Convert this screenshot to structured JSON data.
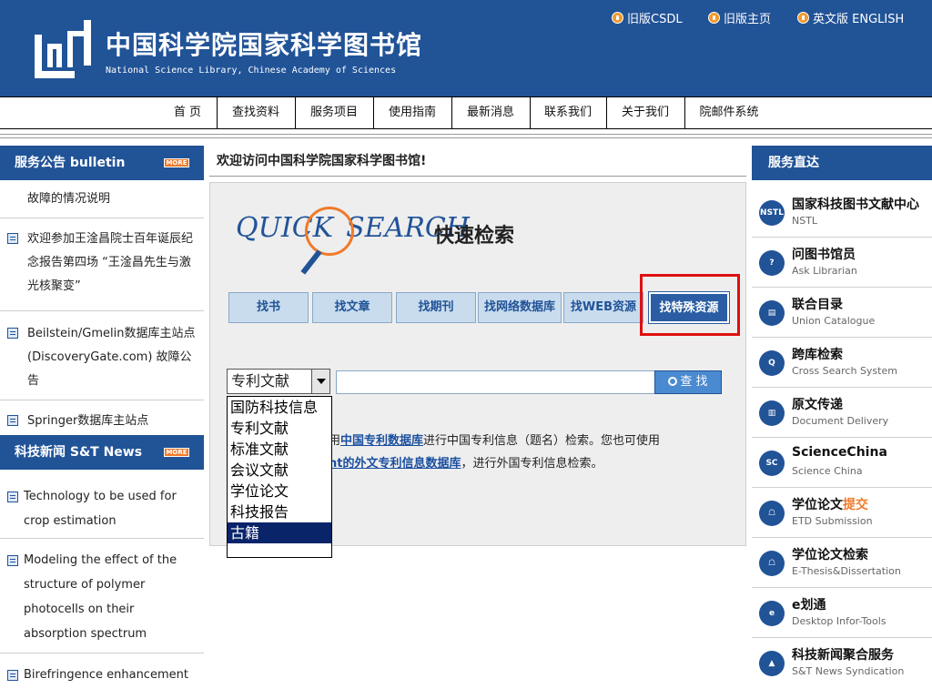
{
  "header": {
    "logo_text": "[]",
    "title": "中国科学院国家科学图书馆",
    "subtitle": "National Science Library, Chinese Academy of Sciences",
    "top_links": [
      "旧版CSDL",
      "旧版主页",
      "英文版 ENGLISH"
    ]
  },
  "nav": {
    "items": [
      "首 页",
      "查找资料",
      "服务项目",
      "使用指南",
      "最新消息",
      "联系我们",
      "关于我们",
      "院邮件系统"
    ]
  },
  "bulletin": {
    "title": "服务公告 bulletin",
    "more": "MORE",
    "items": [
      "故障的情况说明",
      "欢迎参加王淦昌院士百年诞辰纪念报告第四场 “王淦昌先生与激光核聚变”",
      "Beilstein/Gmelin数据库主站点 (DiscoveryGate.com) 故障公告",
      "Springer数据库主站点"
    ]
  },
  "news": {
    "title": "科技新闻 S&T News",
    "more": "MORE",
    "items": [
      "Technology to be used for crop estimation",
      "Modeling the effect of the structure of polymer photocells on their absorption spectrum",
      "Birefringence enhancement"
    ]
  },
  "center": {
    "welcome": "欢迎访问中国科学院国家科学图书馆!",
    "qs_logo_a": "QUICK",
    "qs_logo_b": "SEARCH",
    "qs_title": "快速检索",
    "tabs": [
      "找书",
      "找文章",
      "找期刊",
      "找网络数据库",
      "找WEB资源",
      "找特殊资源"
    ],
    "select_value": "专利文献",
    "search_value": "",
    "search_button": "查 找",
    "hint1_pre": "用",
    "hint1_link": "中国专利数据库",
    "hint1_post": "进行中国专利信息（题名）检索。您也可使用",
    "hint2_link": "nt的外文专利信息数据库",
    "hint2_post": "，进行外国专利信息检索。",
    "dropdown_options": [
      "国防科技信息",
      "专利文献",
      "标准文献",
      "会议文献",
      "学位论文",
      "科技报告",
      "古籍"
    ]
  },
  "services": {
    "title": "服务直达",
    "items": [
      {
        "icon": "NSTL",
        "title": "国家科技图书文献中心",
        "sub": "NSTL"
      },
      {
        "icon": "?",
        "title": "问图书馆员",
        "sub": "Ask Librarian"
      },
      {
        "icon": "▤",
        "title": "联合目录",
        "sub": "Union Catalogue"
      },
      {
        "icon": "Q",
        "title": "跨库检索",
        "sub": "Cross Search System"
      },
      {
        "icon": "▥",
        "title": "原文传递",
        "sub": "Document Delivery"
      },
      {
        "icon": "SC",
        "title": "ScienceChina",
        "sub": "Science China"
      },
      {
        "icon": "☖",
        "title": "学位论文",
        "title_accent": "提交",
        "sub": "ETD Submission"
      },
      {
        "icon": "☖",
        "title": "学位论文检索",
        "sub": "E-Thesis&Dissertation"
      },
      {
        "icon": "e",
        "title": "e划通",
        "sub": "Desktop Infor-Tools"
      },
      {
        "icon": "▲",
        "title": "科技新闻聚合服务",
        "sub": "S&T News Syndication"
      }
    ]
  }
}
